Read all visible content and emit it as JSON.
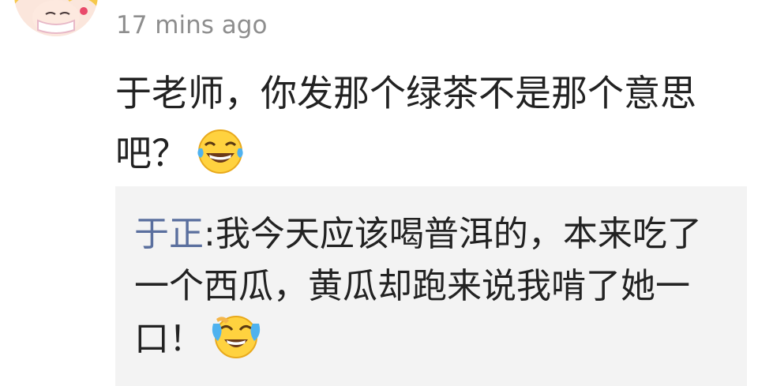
{
  "comment": {
    "timestamp": "17 mins ago",
    "text": "于老师，你发那个绿茶不是那个意思吧？",
    "emoji": "tears-of-joy-emoji"
  },
  "reply": {
    "author": "于正",
    "separator": ":",
    "text": "我今天应该喝普洱的，本来吃了一个西瓜，黄瓜却跑来说我啃了她一口！",
    "emoji": "tears-of-joy-emoji"
  },
  "colors": {
    "timestamp": "#8e8e8e",
    "body_text": "#222222",
    "reply_author": "#5a6f9e",
    "reply_background": "#f3f3f3"
  }
}
